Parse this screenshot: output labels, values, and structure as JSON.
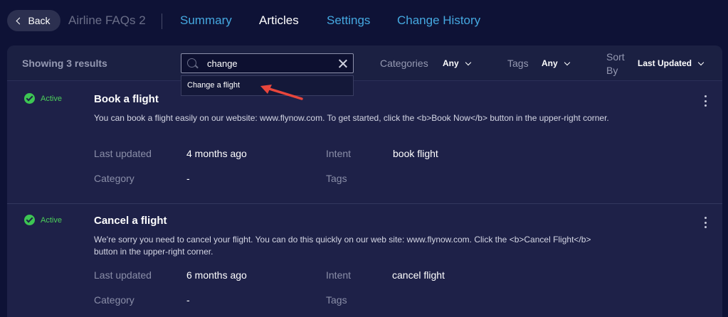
{
  "topnav": {
    "back_label": "Back",
    "app_title": "Airline FAQs 2",
    "tabs": [
      {
        "label": "Summary"
      },
      {
        "label": "Articles"
      },
      {
        "label": "Settings"
      },
      {
        "label": "Change History"
      }
    ]
  },
  "toolbar": {
    "results_count": "Showing 3 results",
    "search_value": "change",
    "suggestion": "Change a flight",
    "categories_label": "Categories",
    "categories_value": "Any",
    "tags_label": "Tags",
    "tags_value": "Any",
    "sortby_label_line1": "Sort",
    "sortby_label_line2": "By",
    "sortby_value": "Last Updated"
  },
  "articles": [
    {
      "status": "Active",
      "title": "Book a flight",
      "description": "You can book a flight easily on our website: www.flynow.com. To get started, click the <b>Book Now</b> button in the upper-right corner.",
      "last_updated_label": "Last updated",
      "last_updated": "4 months ago",
      "intent_label": "Intent",
      "intent": "book flight",
      "category_label": "Category",
      "category": "-",
      "tags_label": "Tags"
    },
    {
      "status": "Active",
      "title": "Cancel a flight",
      "description": "We're sorry you need to cancel your flight. You can do this quickly on our web site: www.flynow.com. Click the <b>Cancel Flight</b> button in the upper-right corner.",
      "last_updated_label": "Last updated",
      "last_updated": "6 months ago",
      "intent_label": "Intent",
      "intent": "cancel flight",
      "category_label": "Category",
      "category": "-",
      "tags_label": "Tags"
    }
  ],
  "colors": {
    "background": "#0e1236",
    "panel": "#1e2148",
    "accent": "#45a8e0",
    "active": "#3dc653",
    "annotation": "#e8463c"
  }
}
